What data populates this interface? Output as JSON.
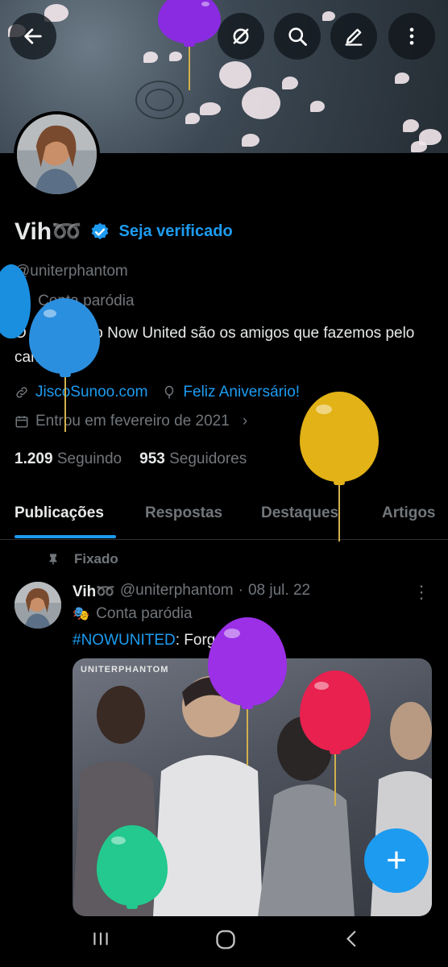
{
  "profile": {
    "name": "Vih➿",
    "verify_label": "Seja verificado",
    "handle": "@uniterphantom",
    "parody_label": "Conta paródia",
    "bio": "O verdadeiro Now United são os amigos que fazemos pelo caminho",
    "website": "JiscoSunoo.com",
    "birthday": "Feliz Aniversário!",
    "joined": "Entrou em fevereiro de 2021",
    "following_count": "1.209",
    "following_label": "Seguindo",
    "followers_count": "953",
    "followers_label": "Seguidores"
  },
  "tabs": [
    {
      "label": "Publicações"
    },
    {
      "label": "Respostas"
    },
    {
      "label": "Destaques"
    },
    {
      "label": "Artigos"
    }
  ],
  "post": {
    "pinned_label": "Fixado",
    "author_name": "Vih➿",
    "author_handle": "@uniterphantom",
    "separator": "·",
    "date": "08 jul. 22",
    "parody_label": "Conta paródia",
    "hashtag": "#NOWUNITED",
    "text": ": Forget me not",
    "media_watermark": "UNITERPHANTOM"
  },
  "colors": {
    "accent": "#1d9bf0",
    "background": "#000000",
    "muted": "#71767b"
  },
  "icons": {
    "back": "arrow-left",
    "no_network": "eye-slash",
    "search": "magnifier",
    "edit": "pencil",
    "more": "vertical-dots",
    "compose": "plus"
  }
}
